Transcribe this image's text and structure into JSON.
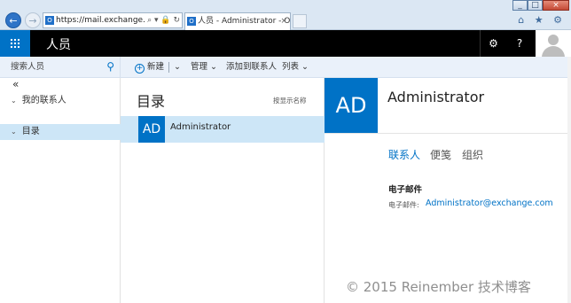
{
  "browser": {
    "address": "https://mail.exchange.com/c",
    "address_icons": "⌕ ▾ 🔒 ↻",
    "tab_title": "人员 - Administrator - Ou...",
    "tab_close": "×",
    "window_controls": [
      "_",
      "□",
      "×"
    ],
    "toolbar_icons": "⌂ ★ ⚙",
    "favicon_letter": "O"
  },
  "topbar": {
    "app_title": "人员",
    "settings_icon": "gear-icon",
    "help_label": "?"
  },
  "commands": {
    "search_placeholder": "搜索人员",
    "new_label": "新建",
    "manage_label": "管理",
    "add_contact_label": "添加到联系人",
    "list_label": "列表"
  },
  "leftnav": {
    "collapse": "«",
    "items": [
      {
        "label": "我的联系人",
        "selected": false
      },
      {
        "label": "目录",
        "selected": true
      }
    ]
  },
  "list": {
    "title": "目录",
    "sort_label": "按显示名称",
    "rows": [
      {
        "initials": "AD",
        "name": "Administrator"
      }
    ]
  },
  "detail": {
    "initials": "AD",
    "name": "Administrator",
    "tabs": [
      "联系人",
      "便笺",
      "组织"
    ],
    "section_title": "电子邮件",
    "email_label": "电子邮件:",
    "email_value": "Administrator@exchange.com"
  },
  "watermark": "© 2015 Reinember 技术博客",
  "colors": {
    "accent": "#0072c6",
    "selected_row": "#cde6f7",
    "topbar": "#000000"
  }
}
